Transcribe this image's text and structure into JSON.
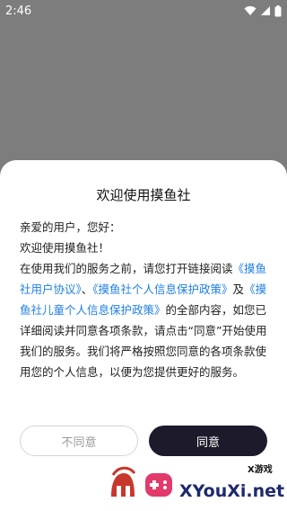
{
  "status_bar": {
    "time": "2:46"
  },
  "dialog": {
    "title": "欢迎使用摸鱼社",
    "greeting": "亲爱的用户，您好：",
    "welcome": "欢迎使用摸鱼社！",
    "intro": "在使用我们的服务之前，请您打开链接阅读",
    "link_user_agreement": "《摸鱼社用户协议》",
    "sep1": "、",
    "link_privacy": "《摸鱼社个人信息保护政策》",
    "and": "及",
    "link_child_privacy": "《摸鱼社儿童个人信息保护政策》",
    "tail": "的全部内容，如您已详细阅读并同意各项条款，请点击“同意”开始使用我们的服务。我们将严格按照您同意的各项条款使用您的个人信息，以便为您提供更好的服务。",
    "disagree_label": "不同意",
    "agree_label": "同意"
  },
  "watermark": {
    "top_text": "X游戏",
    "main_text": "XYouXi.net"
  },
  "colors": {
    "link": "#1f7fe0",
    "agree_bg": "#1c1a2b",
    "overlay": "#7d7d7d"
  }
}
